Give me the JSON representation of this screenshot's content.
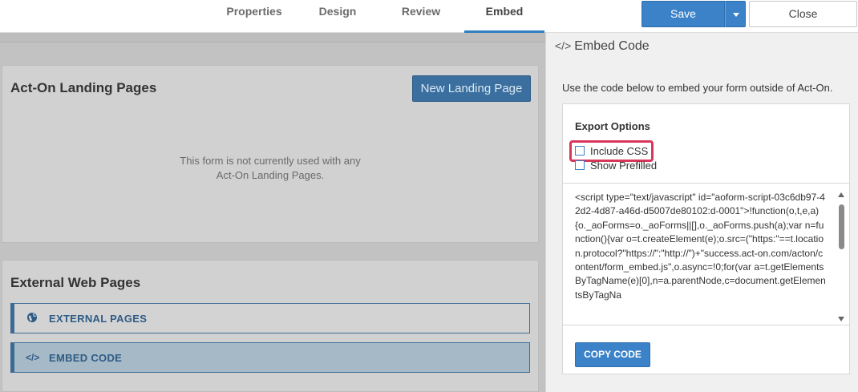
{
  "tabs": [
    {
      "label": "Properties"
    },
    {
      "label": "Design"
    },
    {
      "label": "Review"
    },
    {
      "label": "Embed",
      "active": true
    }
  ],
  "toolbar": {
    "save_label": "Save",
    "close_label": "Close"
  },
  "landing": {
    "title": "Act-On Landing Pages",
    "new_button": "New Landing Page",
    "empty_line1": "This form is not currently used with any",
    "empty_line2": "Act-On Landing Pages."
  },
  "external": {
    "title": "External Web Pages",
    "items": [
      {
        "label": "EXTERNAL PAGES",
        "icon": "globe-icon"
      },
      {
        "label": "EMBED CODE",
        "icon": "code-icon",
        "selected": true
      }
    ]
  },
  "embed_panel": {
    "icon": "code-icon",
    "title": "Embed Code",
    "description": "Use the code below to embed your form outside of Act-On.",
    "export_title": "Export Options",
    "options": [
      {
        "label": "Include CSS",
        "checked": false,
        "highlighted": true
      },
      {
        "label": "Show Prefilled",
        "checked": false
      }
    ],
    "code": "<script type=\"text/javascript\" id=\"aoform-script-03c6db97-42d2-4d87-a46d-d5007de80102:d-0001\">!function(o,t,e,a){o._aoForms=o._aoForms||[],o._aoForms.push(a);var n=function(){var o=t.createElement(e);o.src=(\"https:\"==t.location.protocol?\"https://\":\"http://\")+\"success.act-on.com/acton/content/form_embed.js\",o.async=!0;for(var a=t.getElementsByTagName(e)[0],n=a.parentNode,c=document.getElementsByTagNa",
    "copy_label": "COPY CODE"
  },
  "colors": {
    "accent": "#3b82c9",
    "highlight": "#d9375a",
    "link": "#2e5b85"
  }
}
